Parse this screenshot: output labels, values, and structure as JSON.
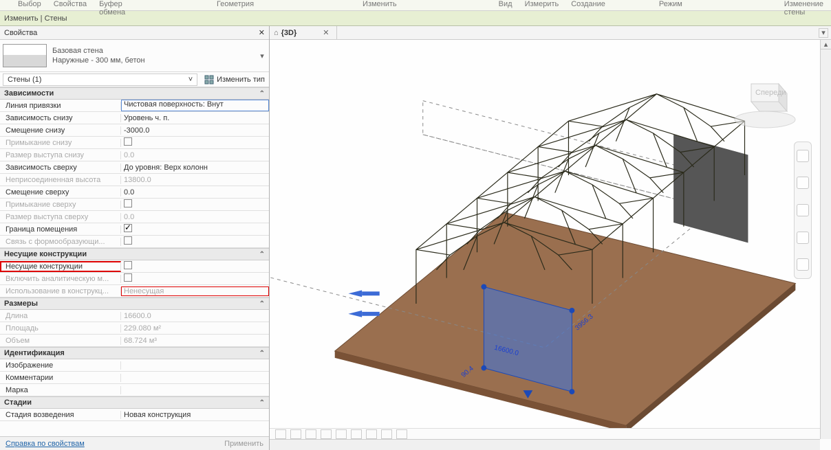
{
  "ribbonTabs": [
    "Выбор",
    "Свойства",
    "Буфер обмена",
    "Геометрия",
    "Изменить",
    "Вид",
    "Измерить",
    "Создание",
    "Режим",
    "Изменение стены"
  ],
  "ribbonBar": "Изменить | Стены",
  "panel": {
    "title": "Свойства"
  },
  "typeSelector": {
    "line1": "Базовая стена",
    "line2": "Наружные - 300 мм, бетон"
  },
  "counterRow": {
    "label": "Стены (1)",
    "editType": "Изменить тип"
  },
  "cats": {
    "deps": "Зависимости",
    "struct": "Несущие конструкции",
    "dims": "Размеры",
    "ident": "Идентификация",
    "stages": "Стадии"
  },
  "rows": {
    "r1": {
      "k": "Линия привязки",
      "v": "Чистовая поверхность: Внут"
    },
    "r2": {
      "k": "Зависимость снизу",
      "v": "Уровень ч. п."
    },
    "r3": {
      "k": "Смещение снизу",
      "v": "-3000.0"
    },
    "r4": {
      "k": "Примыкание снизу",
      "v": ""
    },
    "r5": {
      "k": "Размер выступа снизу",
      "v": "0.0"
    },
    "r6": {
      "k": "Зависимость сверху",
      "v": "До уровня: Верх колонн"
    },
    "r7": {
      "k": "Неприсоединенная высота",
      "v": "13800.0"
    },
    "r8": {
      "k": "Смещение сверху",
      "v": "0.0"
    },
    "r9": {
      "k": "Примыкание сверху",
      "v": ""
    },
    "r10": {
      "k": "Размер выступа сверху",
      "v": "0.0"
    },
    "r11": {
      "k": "Граница помещения",
      "v": ""
    },
    "r12": {
      "k": "Связь с формообразующи...",
      "v": ""
    },
    "s1": {
      "k": "Несущие конструкции",
      "v": ""
    },
    "s2": {
      "k": "Включить аналитическую м...",
      "v": ""
    },
    "s3": {
      "k": "Использование в конструкц...",
      "v": "Ненесущая"
    },
    "d1": {
      "k": "Длина",
      "v": "16600.0"
    },
    "d2": {
      "k": "Площадь",
      "v": "229.080 м²"
    },
    "d3": {
      "k": "Объем",
      "v": "68.724 м³"
    },
    "i1": {
      "k": "Изображение",
      "v": ""
    },
    "i2": {
      "k": "Комментарии",
      "v": ""
    },
    "i3": {
      "k": "Марка",
      "v": ""
    },
    "st1": {
      "k": "Стадия возведения",
      "v": "Новая конструкция"
    }
  },
  "footer": {
    "help": "Справка по свойствам",
    "apply": "Применить"
  },
  "tab3d": "{3D}",
  "dims3d": {
    "a": "16600.0",
    "b": "90.4",
    "c": "3956.3"
  }
}
